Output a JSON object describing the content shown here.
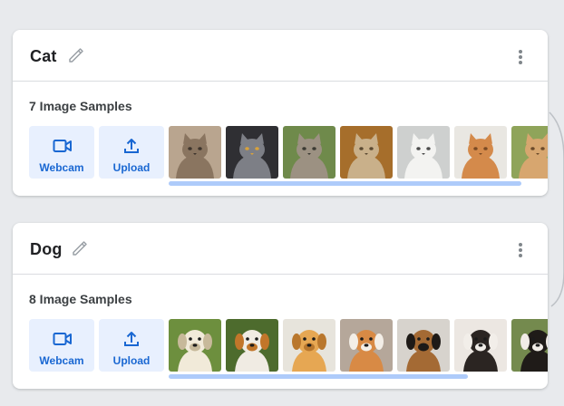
{
  "classes": [
    {
      "name": "Cat",
      "samples_label": "7 Image Samples",
      "webcam_label": "Webcam",
      "upload_label": "Upload",
      "thumbs": [
        {
          "icon": "cat-photo",
          "bg": "#b9a58f",
          "fur": "#8a7560",
          "accent": "#3d342c"
        },
        {
          "icon": "cat-photo",
          "bg": "#2f2f33",
          "fur": "#7d7f86",
          "accent": "#d9a23a"
        },
        {
          "icon": "cat-photo",
          "bg": "#6f8a4b",
          "fur": "#9c9182",
          "accent": "#3b3a33"
        },
        {
          "icon": "cat-photo",
          "bg": "#a66e2b",
          "fur": "#c9b08a",
          "accent": "#5b4a32"
        },
        {
          "icon": "cat-photo",
          "bg": "#ced0cf",
          "fur": "#f3f3f1",
          "accent": "#4c4c4c"
        },
        {
          "icon": "cat-photo",
          "bg": "#e9e7e2",
          "fur": "#d48a4b",
          "accent": "#7a4a24"
        },
        {
          "icon": "cat-photo",
          "bg": "#8fa45a",
          "fur": "#d7a66f",
          "accent": "#6b4a2a"
        }
      ]
    },
    {
      "name": "Dog",
      "samples_label": "8 Image Samples",
      "webcam_label": "Webcam",
      "upload_label": "Upload",
      "thumbs": [
        {
          "icon": "dog-photo",
          "bg": "#6d8f3e",
          "fur": "#f1ead9",
          "accent": "#c7b99a"
        },
        {
          "icon": "dog-photo",
          "bg": "#4d6b2d",
          "fur": "#f0ebe3",
          "accent": "#c2762a"
        },
        {
          "icon": "dog-photo",
          "bg": "#e7e4dc",
          "fur": "#e6a753",
          "accent": "#b9772d"
        },
        {
          "icon": "dog-photo",
          "bg": "#b5a79a",
          "fur": "#d88a45",
          "accent": "#f3eee7"
        },
        {
          "icon": "dog-photo",
          "bg": "#d7d3cd",
          "fur": "#a46a34",
          "accent": "#1e1a17"
        },
        {
          "icon": "dog-photo",
          "bg": "#ece7e2",
          "fur": "#2b2522",
          "accent": "#f2eee9"
        },
        {
          "icon": "dog-photo",
          "bg": "#748a4e",
          "fur": "#1f1b18",
          "accent": "#f1ece6"
        },
        {
          "icon": "dog-photo",
          "bg": "#8a9a6a",
          "fur": "#c98d4e",
          "accent": "#f0e9e0"
        }
      ]
    }
  ],
  "colors": {
    "page_bg": "#e8eaed",
    "card_bg": "#ffffff",
    "accent_blue": "#1967d2",
    "button_bg": "#e8f0fe",
    "scroll_bar": "#aecbfa",
    "divider": "#dadce0",
    "icon_gray": "#80868b"
  },
  "scroll": {
    "cat_visible_fraction": 0.93,
    "dog_visible_fraction": 0.79
  }
}
